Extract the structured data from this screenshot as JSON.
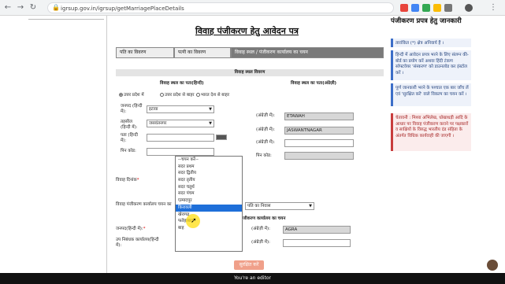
{
  "browser": {
    "url": "igrsup.gov.in/igrsup/getMarriagePlaceDetails"
  },
  "page_title": "विवाह पंजीकरण हेतु आवेदन पत्र",
  "tabs": [
    "पति का विवरण",
    "पत्नी का विवरण",
    "विवाह स्थल / पंजीकरण कार्यालय का चयन"
  ],
  "sections": {
    "venue_head": "विवाह स्थल विवरण",
    "col_hindi": "विवाह स्थल का पता(हिन्दी)",
    "col_english": "विवाह स्थल का पता(अंग्रेज़ी)",
    "office_head": "पंजीकरण कार्यालय का चयन"
  },
  "radios": [
    "उत्तर प्रदेश में",
    "उत्तर प्रदेश से बाहर",
    "भारत देश से बाहर"
  ],
  "form": {
    "district_label": "जनपद (हिन्दी में):",
    "district_value": "इटावा",
    "tehsil_label": "तहसील (हिन्दी में):",
    "tehsil_value": "जसवंतनगर",
    "address_label": "पता (हिन्दी में):",
    "pincode_label": "पिन कोड:",
    "eng_district_label": "(अंग्रेज़ी में):",
    "eng_district_value": "ETAWAH",
    "eng_tehsil_label": "(अंग्रेज़ी में):",
    "eng_tehsil_value": "JASWANTNAGAR",
    "eng_address_label": "(अंग्रेज़ी में):",
    "eng_pincode_label": "पिन कोड:",
    "marriage_date_label": "विवाह दिनांक",
    "office_select_label": "विवाह पंजीकरण कार्यालय चयन का",
    "office_select_value": "पति का निवास",
    "office_district_label": "जनपद(हिन्दी में):",
    "office_district_eng_label": "(अंग्रेज़ी में):",
    "office_district_eng_value": "AGRA",
    "sub_registrar_label": "उप निबंधक कार्यालय(हिन्दी में):",
    "sub_registrar_value": "--चयन करें--",
    "sub_registrar_eng_label": "(अंग्रेज़ी में):",
    "submit_label": "सुरक्षित करें"
  },
  "dropdown_options": [
    "--चयन करें--",
    "सदर प्रथम",
    "सदर द्वितीय",
    "सदर तृतीय",
    "सदर चतुर्थ",
    "सदर पंचम",
    "एत्मादपुर",
    "किरावली",
    "खेरागढ़",
    "फतेहाबाद",
    "बाह"
  ],
  "dropdown_highlight_index": 7,
  "sidebar": {
    "title": "पंजीकरण प्रपत्र हेतु जानकारी",
    "note1": "तारांकित (*) क्षेत्र अनिवार्य हैं ।",
    "note2": "हिन्दी में आवेदन प्रपत्र भरने के लिए संलग्न की-बोर्ड का प्रयोग करें अथवा हिंदी टंकण सॉफ्टवेयर 'संस्करण' को डाउनलोड कर इंस्टॉल करें ।",
    "note3": "पूर्ण जानकारी भरने के पश्चात एक बार जाँच लें एवं 'सुरक्षित करें' वाले विकल्प का चयन करें ।",
    "warning": "चेतावनी : मिथ्या अभिलेख, धोखाधड़ी आदि के आधार पर विवाह पंजीकरण कराने पर पक्षकारों व साक्षियों के विरुद्ध भारतीय दंड संहिता के अंतर्गत विधिक कार्यवाही की जाएगी ।"
  },
  "status_text": "You're an editor"
}
